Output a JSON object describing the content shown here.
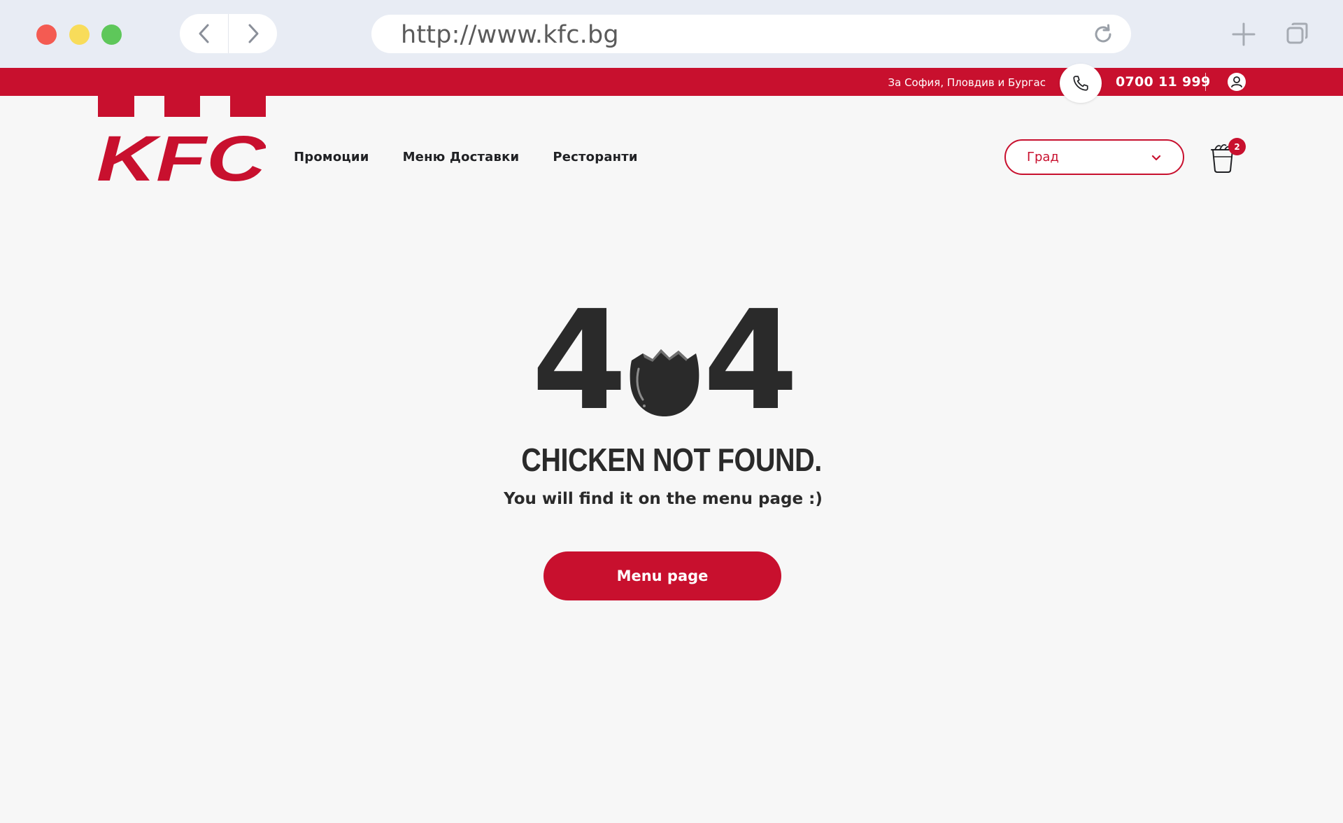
{
  "browser": {
    "url": "http://www.kfc.bg",
    "back_icon": "chevron-left-icon",
    "forward_icon": "chevron-right-icon",
    "reload_icon": "reload-icon",
    "new_tab_icon": "plus-icon",
    "tabs_icon": "tabs-icon"
  },
  "topbar": {
    "cities": "За София, Пловдив и Бургас",
    "phone": "0700 11 999",
    "phone_icon": "phone-icon",
    "user_icon": "user-icon"
  },
  "brand": {
    "name": "KFC",
    "color": "#c8102e"
  },
  "nav": {
    "items": [
      {
        "label": "Промоции"
      },
      {
        "label": "Меню Доставки"
      },
      {
        "label": "Ресторанти"
      }
    ]
  },
  "city_select": {
    "placeholder": "Град"
  },
  "cart": {
    "count": "2",
    "icon": "cart-bucket-icon"
  },
  "error": {
    "digit_left": "4",
    "digit_right": "4",
    "egg_icon": "broken-egg-icon",
    "headline": "CHICKEN NOT FOUND.",
    "subline": "You will find it on the menu page :)",
    "button_label": "Menu page"
  }
}
